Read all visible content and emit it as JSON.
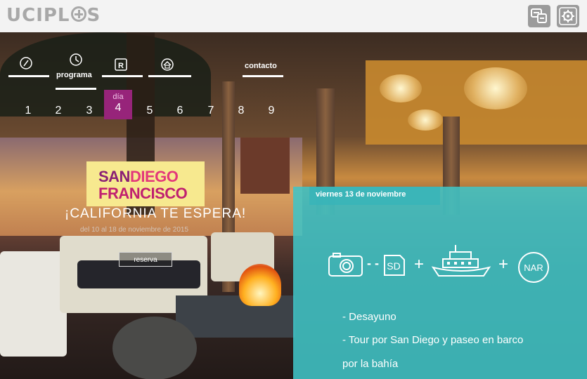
{
  "topbar": {
    "logo_text": "UCIPL",
    "logo_text_end": "S",
    "buttons": [
      {
        "icon": "chat-device-icon"
      },
      {
        "icon": "settings-gear-icon"
      }
    ]
  },
  "nav": {
    "items": [
      {
        "icon": "compass-icon",
        "label": ""
      },
      {
        "icon": "clock-icon",
        "label": "programa"
      },
      {
        "icon": "brand-r-icon",
        "label": ""
      },
      {
        "icon": "building-icon",
        "label": ""
      },
      {
        "icon": "",
        "label": "contacto"
      }
    ],
    "active": "programa"
  },
  "days": {
    "items": [
      "1",
      "2",
      "3",
      "4",
      "5",
      "6",
      "7",
      "8",
      "9"
    ],
    "active_label": "día",
    "active_number": "4"
  },
  "promo": {
    "logo_line1a": "SAN",
    "logo_line1b": "DIEGO",
    "logo_line2": "FRANCISCO",
    "tagline": "¡CALIFORNIA TE ESPERA!",
    "subtagline": "del 10 al 18 de noviembre de 2015",
    "button_label": "reserva"
  },
  "panel": {
    "date": "viernes 13 de noviembre",
    "icons": [
      "camera-icon",
      "sd-card-icon",
      "ship-icon",
      "nar-icon"
    ],
    "dash": "- -",
    "plus": "+",
    "sd_text": "SD",
    "nar_text": "NAR",
    "items": [
      "- Desayuno",
      "- Tour por San Diego y paseo en barco",
      "por la bahía"
    ]
  },
  "colors": {
    "topbar_bg": "#f3f3f3",
    "accent_magenta": "#97247a",
    "panel_teal": "#40c4c6",
    "promo_yellow": "#f7e98f"
  }
}
